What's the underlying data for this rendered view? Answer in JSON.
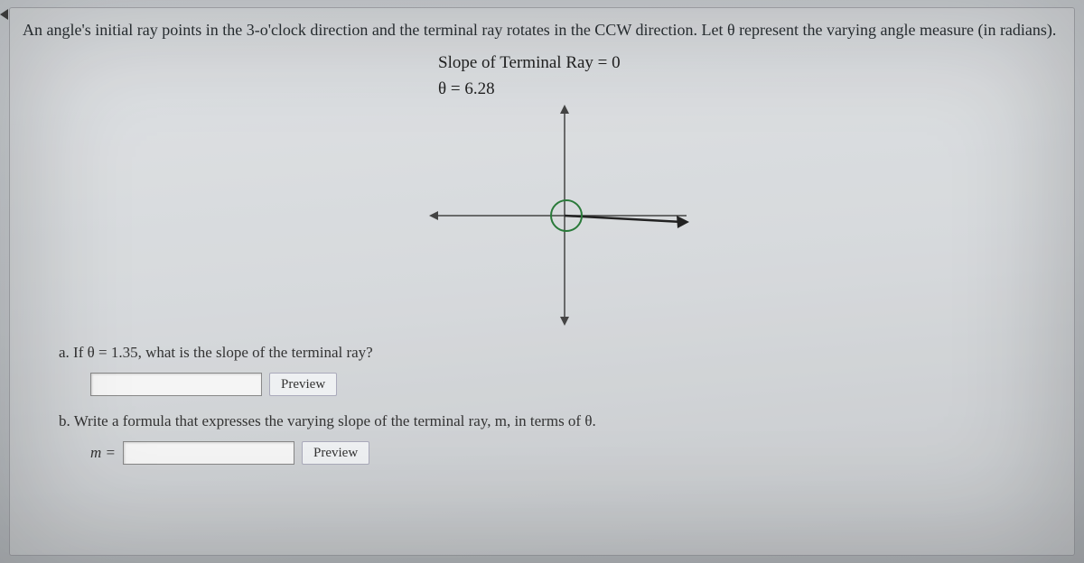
{
  "problem_statement": "An angle's initial ray points in the 3-o'clock direction and the terminal ray rotates in the CCW direction. Let θ represent the varying angle measure (in radians).",
  "diagram": {
    "slope_label": "Slope of Terminal Ray = 0",
    "theta_label": "θ = 6.28"
  },
  "questions": {
    "a": {
      "text": "a. If θ = 1.35, what is the slope of the terminal ray?",
      "input_value": "",
      "preview": "Preview"
    },
    "b": {
      "text": "b. Write a formula that expresses the varying slope of the terminal ray, m, in terms of θ.",
      "prefix": "m =",
      "input_value": "",
      "preview": "Preview"
    }
  }
}
